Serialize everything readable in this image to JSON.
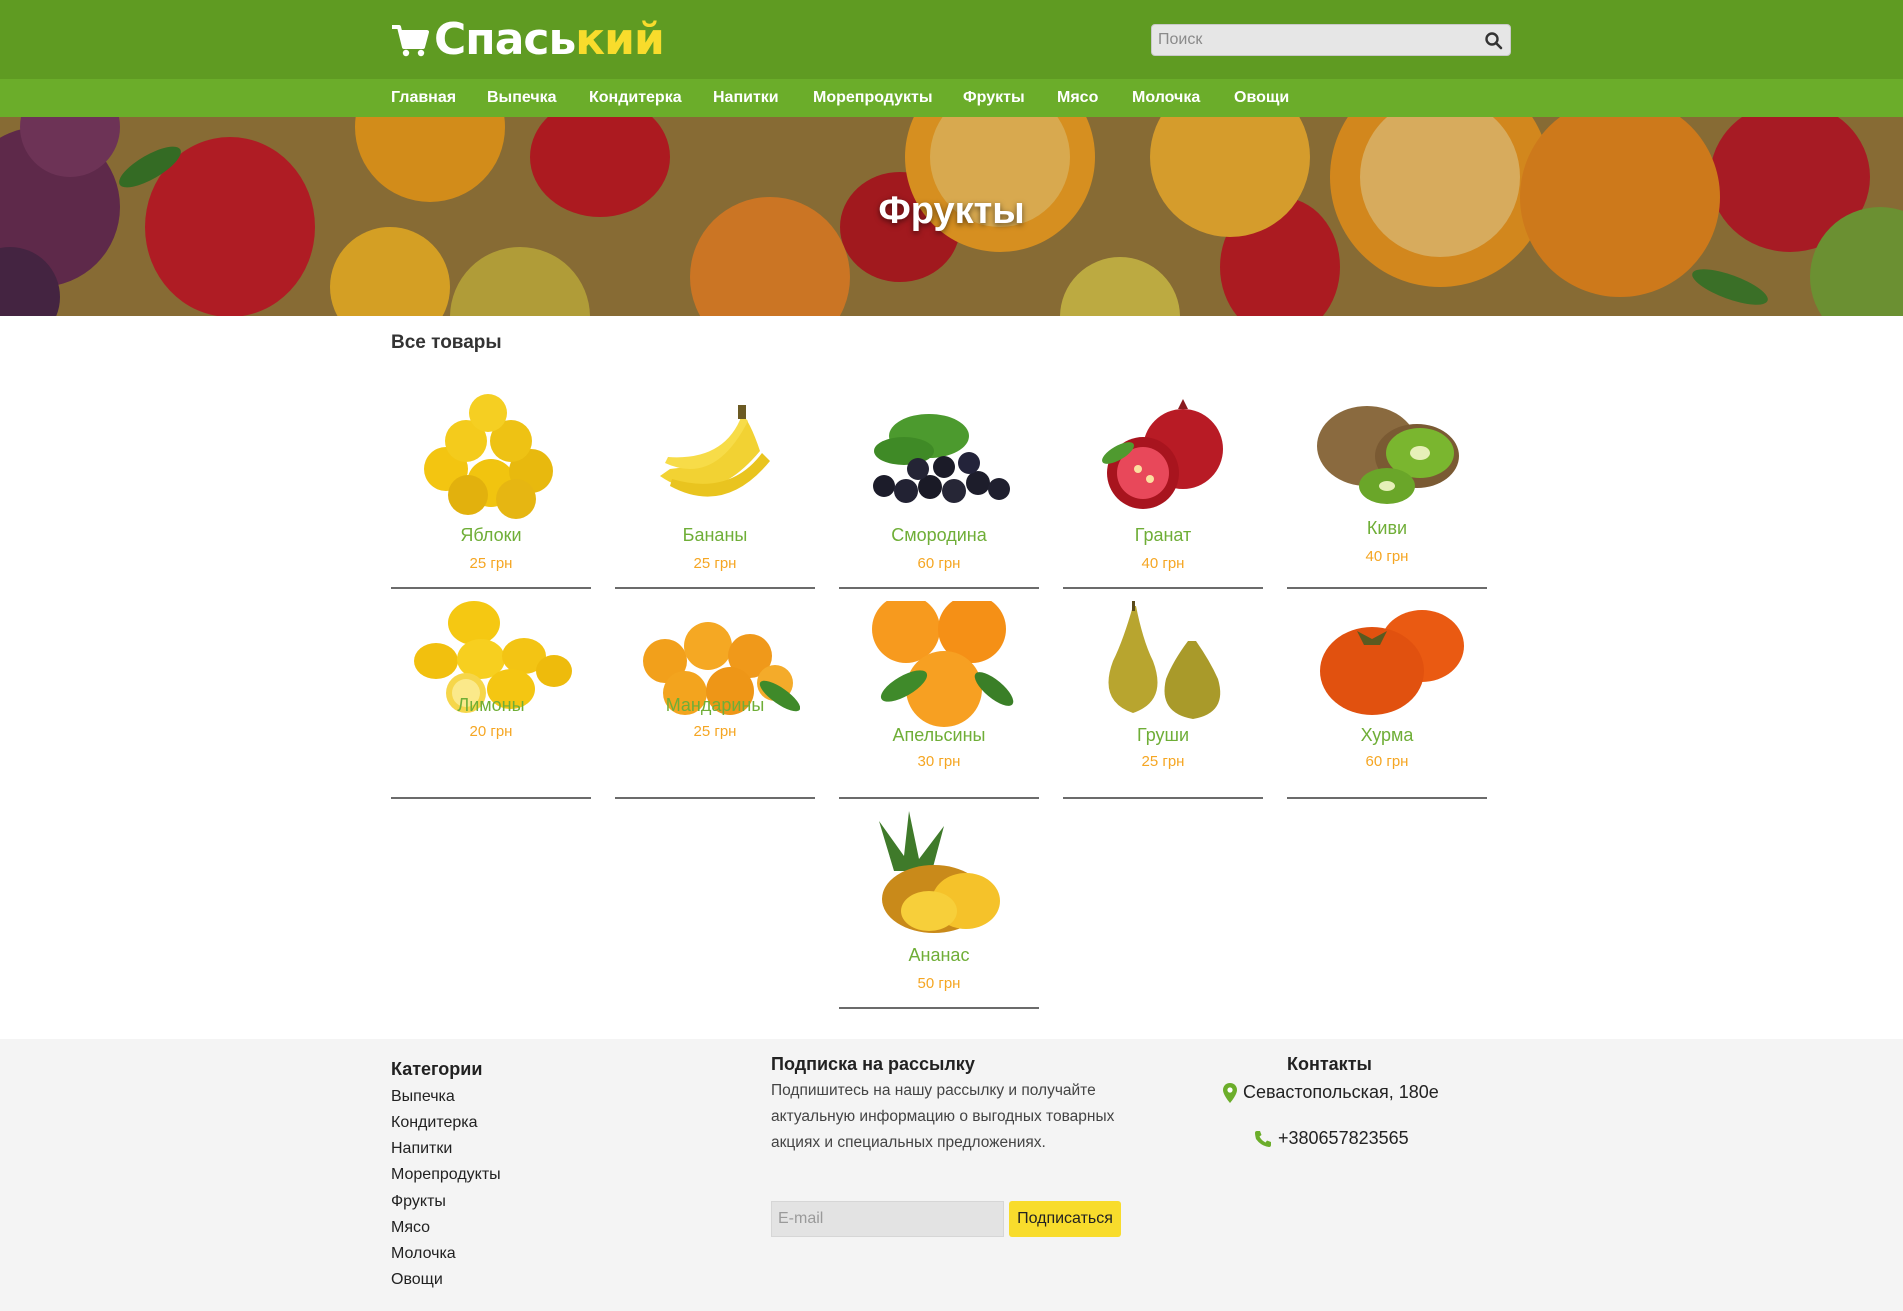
{
  "header": {
    "logo_part1": "Спась",
    "logo_part2": "кий",
    "search_placeholder": "Поиск",
    "search_icon": "search-icon",
    "cart_icon": "cart-icon"
  },
  "nav": [
    {
      "label": "Главная"
    },
    {
      "label": "Выпечка"
    },
    {
      "label": "Кондитерка"
    },
    {
      "label": "Напитки"
    },
    {
      "label": "Морепродукты"
    },
    {
      "label": "Фрукты"
    },
    {
      "label": "Мясо"
    },
    {
      "label": "Молочка"
    },
    {
      "label": "Овощи"
    }
  ],
  "hero": {
    "title": "Фрукты"
  },
  "main": {
    "section_title": "Все товары"
  },
  "products": [
    {
      "name": "Яблоки",
      "price": "25 грн",
      "icon": "apples-icon"
    },
    {
      "name": "Бананы",
      "price": "25 грн",
      "icon": "bananas-icon"
    },
    {
      "name": "Смородина",
      "price": "60 грн",
      "icon": "currant-icon"
    },
    {
      "name": "Гранат",
      "price": "40 грн",
      "icon": "pomegranate-icon"
    },
    {
      "name": "Киви",
      "price": "40 грн",
      "icon": "kiwi-icon"
    },
    {
      "name": "Лимоны",
      "price": "20 грн",
      "icon": "lemons-icon"
    },
    {
      "name": "Мандарины",
      "price": "25 грн",
      "icon": "mandarins-icon"
    },
    {
      "name": "Апельсины",
      "price": "30 грн",
      "icon": "oranges-icon"
    },
    {
      "name": "Груши",
      "price": "25 грн",
      "icon": "pears-icon"
    },
    {
      "name": "Хурма",
      "price": "60 грн",
      "icon": "persimmon-icon"
    },
    {
      "name": "Ананас",
      "price": "50 грн",
      "icon": "pineapple-icon"
    }
  ],
  "footer": {
    "categories_title": "Категории",
    "categories": [
      "Выпечка",
      "Кондитерка",
      "Напитки",
      "Морепродукты",
      "Фрукты",
      "Мясо",
      "Молочка",
      "Овощи"
    ],
    "subscribe_title": "Подписка на рассылку",
    "subscribe_text": "Подпишитесь на нашу рассылку и получайте актуальную информацию о выгодных товарных акциях и специальных предложениях.",
    "email_placeholder": "E-mail",
    "subscribe_button": "Подписаться",
    "contacts_title": "Контакты",
    "address": "Севастопольская, 180е",
    "phone": "+380657823565",
    "address_icon": "map-marker-icon",
    "phone_icon": "phone-icon"
  },
  "colors": {
    "header_green": "#5f9b22",
    "nav_green": "#6bad2a",
    "logo_yellow": "#f8dc2c",
    "product_name_green": "#6fae37",
    "price_orange": "#f5a623",
    "button_yellow": "#f8dc2c",
    "footer_bg": "#f4f4f4"
  }
}
